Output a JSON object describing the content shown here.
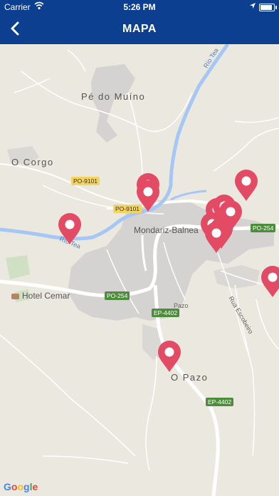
{
  "status_bar": {
    "carrier": "Carrier",
    "time": "5:26 PM"
  },
  "nav": {
    "title": "MAPA"
  },
  "map": {
    "places": {
      "pe_do_muino": "Pé do Muíno",
      "o_corgo": "O Corgo",
      "mondariz": "Mondariz-Balnea",
      "hotel": "Hotel Cemar",
      "o_pazo": "O Pazo",
      "pazo": "Pazo",
      "rua_escobeiro": "Rua Escobeiro"
    },
    "rivers": {
      "rio_tea_top": "Río Tea",
      "rio_tea_left": "Río Tea"
    },
    "roads": {
      "po9101_a": "PO-9101",
      "po9101_b": "PO-9101",
      "po254_a": "PO-254",
      "po254_b": "PO-254",
      "ep4402_a": "EP-4402",
      "ep4402_b": "EP-4402"
    },
    "attribution": "Google",
    "marker_color": "#e24b63"
  }
}
